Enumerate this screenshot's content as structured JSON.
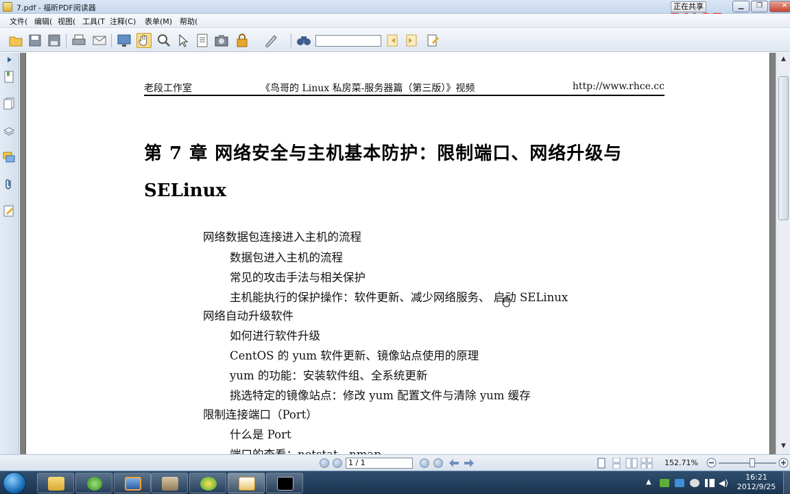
{
  "window": {
    "title": "7.pdf - 福昕PDF阅读器",
    "share_button": "正在共享",
    "watermark": "RHCE.cc"
  },
  "menu": [
    "文件(",
    "编辑(",
    "视图(",
    "工具(T",
    "注释(C)",
    "表单(M)",
    "帮助("
  ],
  "toolbar": {
    "icons": [
      "open-icon",
      "save-icon",
      "save-as-icon",
      "print-icon",
      "email-icon",
      "fullscreen-icon",
      "hand-tool-icon",
      "zoom-tool-icon",
      "select-icon",
      "text-select-icon",
      "snapshot-icon",
      "rms-icon",
      "typewriter-icon",
      "find-icon",
      "find-prev-icon",
      "find-next-icon",
      "find-options-icon"
    ],
    "find_value": ""
  },
  "leftnav": {
    "icons": [
      "bookmarks-icon",
      "pages-icon",
      "layers-icon",
      "comments-icon",
      "attachments-icon",
      "signatures-icon"
    ]
  },
  "document": {
    "header": {
      "left": "老段工作室",
      "center": "《鸟哥的 Linux 私房菜-服务器篇（第三版）》视频",
      "right": "http://www.rhce.cc"
    },
    "chapter_title_line1": "第 7 章  网络安全与主机基本防护：限制端口、网络升级与",
    "chapter_title_line2": "SELinux",
    "toc": [
      {
        "text": "网络数据包连接进入主机的流程",
        "level": 1
      },
      {
        "text": "数据包进入主机的流程",
        "level": 2
      },
      {
        "text": "常见的攻击手法与相关保护",
        "level": 2
      },
      {
        "text": "主机能执行的保护操作：软件更新、减少网络服务、  启动  SELinux",
        "level": 2
      },
      {
        "text": "网络自动升级软件",
        "level": 1
      },
      {
        "text": "如何进行软件升级",
        "level": 2
      },
      {
        "text": "CentOS  的  yum  软件更新、镜像站点使用的原理",
        "level": 2
      },
      {
        "text": "yum  的功能：安装软件组、全系统更新",
        "level": 2
      },
      {
        "text": "挑选特定的镜像站点：修改  yum  配置文件与清除  yum  缓存",
        "level": 2
      },
      {
        "text": "限制连接端口（Port）",
        "level": 1
      },
      {
        "text": "什么是 Port",
        "level": 2
      },
      {
        "text": "端口的查看：netstat、nmap",
        "level": 2
      }
    ]
  },
  "statusbar": {
    "page_value": "1 / 1",
    "zoom": "152.71%"
  },
  "taskbar": {
    "apps": [
      "windows-explorer-icon",
      "sync-icon",
      "virtualbox-icon",
      "archive-icon",
      "parrot-icon",
      "foxit-reader-icon",
      "command-prompt-icon"
    ],
    "clock_time": "16:21",
    "clock_date": "2012/9/25"
  }
}
